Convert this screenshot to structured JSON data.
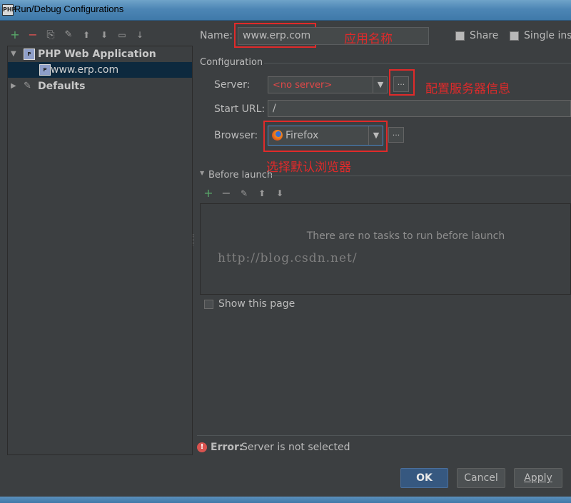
{
  "window": {
    "title": "Run/Debug Configurations",
    "icon_text": "PHP"
  },
  "toolbar": {
    "icons": [
      "add-icon",
      "remove-icon",
      "copy-icon",
      "wrench-icon",
      "move-up-icon",
      "move-down-icon",
      "folder-icon",
      "sort-icon"
    ],
    "glyphs": [
      "+",
      "−",
      "⎘",
      "✎",
      "⬆",
      "⬇",
      "▭",
      "↓"
    ]
  },
  "tree": {
    "group_label": "PHP Web Application",
    "item_label": "www.erp.com",
    "defaults_label": "Defaults",
    "expand_glyph": "▼",
    "collapse_glyph": "▶"
  },
  "name": {
    "label": "Name:",
    "value": "www.erp.com",
    "note": "应用名称"
  },
  "share": {
    "label": "Share"
  },
  "single_instance": {
    "label": "Single inst"
  },
  "configuration": {
    "section_label": "Configuration",
    "server": {
      "label": "Server:",
      "value": "<no server>",
      "note": "配置服务器信息"
    },
    "start_url": {
      "label": "Start URL:",
      "value": "/"
    },
    "browser": {
      "label": "Browser:",
      "value": "Firefox",
      "note": "选择默认浏览器"
    },
    "dots": "..."
  },
  "before_launch": {
    "label": "Before launch",
    "empty_text": "There are no tasks to run before launch",
    "watermark": "http://blog.csdn.net/",
    "icons": [
      "add-task-icon",
      "remove-task-icon",
      "edit-task-icon",
      "move-task-up-icon",
      "move-task-down-icon"
    ],
    "glyphs": [
      "+",
      "−",
      "✎",
      "⬆",
      "⬇"
    ]
  },
  "show_page": {
    "label": "Show this page"
  },
  "error": {
    "prefix": "Error:",
    "message": "Server is not selected"
  },
  "buttons": {
    "ok": "OK",
    "cancel": "Cancel",
    "apply": "Apply"
  },
  "colors": {
    "accent_red": "#e02a2a",
    "selection": "#0d293e",
    "primary_button": "#365880"
  }
}
